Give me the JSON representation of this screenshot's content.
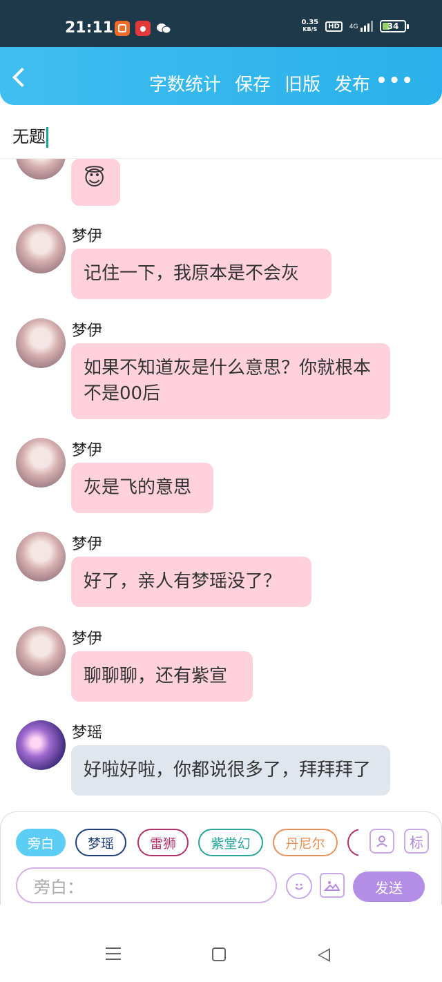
{
  "status": {
    "time": "21:11",
    "net_speed": "0.35",
    "net_unit": "KB/S",
    "hd": "HD",
    "signal": "4G",
    "battery": "34"
  },
  "header": {
    "actions": [
      "字数统计",
      "保存",
      "旧版",
      "发布"
    ],
    "more": "•••"
  },
  "doc": {
    "title": "无题"
  },
  "messages": [
    {
      "name": "",
      "text": "😇",
      "style": "pink"
    },
    {
      "name": "梦伊",
      "text": "记住一下，我原本是不会灰",
      "style": "pink"
    },
    {
      "name": "梦伊",
      "text": "如果不知道灰是什么意思？你就根本不是00后",
      "style": "pink"
    },
    {
      "name": "梦伊",
      "text": "灰是飞的意思",
      "style": "pink"
    },
    {
      "name": "梦伊",
      "text": "好了，亲人有梦瑶没了？",
      "style": "pink"
    },
    {
      "name": "梦伊",
      "text": "聊聊聊，还有紫宣",
      "style": "pink"
    },
    {
      "name": "梦瑶",
      "text": "好啦好啦，你都说很多了，拜拜拜了",
      "style": "gray"
    }
  ],
  "roles": [
    {
      "label": "旁白",
      "color": "#29b6f0",
      "active": true
    },
    {
      "label": "梦瑶",
      "color": "#1f3f7a",
      "active": false
    },
    {
      "label": "雷狮",
      "color": "#b0306a",
      "active": false
    },
    {
      "label": "紫堂幻",
      "color": "#26a69a",
      "active": false
    },
    {
      "label": "丹尼尔",
      "color": "#e8915a",
      "active": false
    },
    {
      "label": "",
      "color": "#b0306a",
      "active": false
    }
  ],
  "toolbar": {
    "role_btn_icon": "person-card-icon",
    "tag_label": "标"
  },
  "composer": {
    "placeholder": "旁白：",
    "send_label": "发送"
  }
}
